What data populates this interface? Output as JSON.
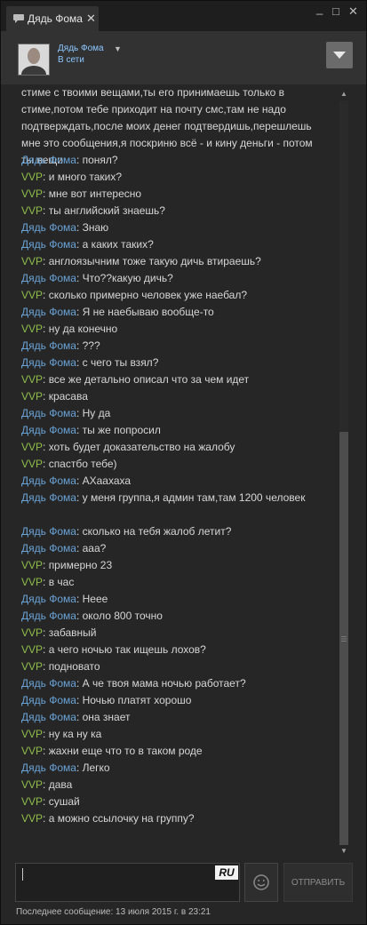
{
  "tab": {
    "title": "Дядь Фома",
    "close": "✕"
  },
  "window_controls": {
    "minimize": "_",
    "maximize": "□",
    "close": "✕"
  },
  "contact": {
    "name": "Дядь Фома",
    "status": "В сети"
  },
  "messages": [
    {
      "sender": "",
      "text": "стиме с твоими вещами,ты его принимаешь только в стиме,потом тебе приходит на почту смс,там не надо подтверждать,после моих денег подтвердишь,перешлешь мне это сообщения,я поскриню всё - и кину деньги - потом ты вещи"
    },
    {
      "sender": "Дядь Фома",
      "text": "понял?"
    },
    {
      "sender": "VVP",
      "text": "и много таких?"
    },
    {
      "sender": "VVP",
      "text": "мне вот интересно"
    },
    {
      "sender": "VVP",
      "text": "ты английский знаешь?"
    },
    {
      "sender": "Дядь Фома",
      "text": "Знаю"
    },
    {
      "sender": "Дядь Фома",
      "text": "а каких таких?"
    },
    {
      "sender": "VVP",
      "text": "англоязычним тоже такую дичь втираешь?"
    },
    {
      "sender": "Дядь Фома",
      "text": "Что??какую дичь?"
    },
    {
      "sender": "VVP",
      "text": "сколько примерно человек уже наебал?"
    },
    {
      "sender": "Дядь Фома",
      "text": "Я не наебываю вообще-то"
    },
    {
      "sender": "VVP",
      "text": "ну да конечно"
    },
    {
      "sender": "Дядь Фома",
      "text": "???"
    },
    {
      "sender": "Дядь Фома",
      "text": "с чего ты взял?"
    },
    {
      "sender": "VVP",
      "text": "все же детально описал что за чем идет"
    },
    {
      "sender": "VVP",
      "text": "красава"
    },
    {
      "sender": "Дядь Фома",
      "text": "Ну да"
    },
    {
      "sender": "Дядь Фома",
      "text": "ты же попросил"
    },
    {
      "sender": "VVP",
      "text": "хоть будет доказательство на жалобу"
    },
    {
      "sender": "VVP",
      "text": "спастбо тебе)"
    },
    {
      "sender": "Дядь Фома",
      "text": "АХаахаха"
    },
    {
      "sender": "Дядь Фома",
      "text": "у меня группа,я админ там,там 1200 человек"
    },
    {
      "sender": "Дядь Фома",
      "text": "сколько на тебя жалоб летит?"
    },
    {
      "sender": "Дядь Фома",
      "text": "ааа?"
    },
    {
      "sender": "VVP",
      "text": "примерно 23"
    },
    {
      "sender": "VVP",
      "text": "в час"
    },
    {
      "sender": "Дядь Фома",
      "text": "Неее"
    },
    {
      "sender": "Дядь Фома",
      "text": "около 800 точно"
    },
    {
      "sender": "VVP",
      "text": "забавный"
    },
    {
      "sender": "VVP",
      "text": "а чего ночью так ищешь лохов?"
    },
    {
      "sender": "VVP",
      "text": "подновато"
    },
    {
      "sender": "Дядь Фома",
      "text": "А че твоя мама ночью работает?"
    },
    {
      "sender": "Дядь Фома",
      "text": "Ночью платят хорошо"
    },
    {
      "sender": "Дядь Фома",
      "text": "она знает"
    },
    {
      "sender": "VVP",
      "text": "ну ка ну ка"
    },
    {
      "sender": "VVP",
      "text": "жахни еще что то в таком роде"
    },
    {
      "sender": "Дядь Фома",
      "text": "Легко"
    },
    {
      "sender": "VVP",
      "text": "дава"
    },
    {
      "sender": "VVP",
      "text": "сушай"
    },
    {
      "sender": "VVP",
      "text": "а можно ссылочку на группу?"
    }
  ],
  "input": {
    "value": "",
    "lang": "RU"
  },
  "send_label": "ОТПРАВИТЬ",
  "last_message": "Последнее сообщение: 13 июля 2015 г. в 23:21",
  "colors": {
    "sender_a": "#6aa3d6",
    "sender_b": "#8ebd4a",
    "text": "#d6d6d6"
  },
  "icons": [
    "chat-icon",
    "close-icon",
    "minimize-icon",
    "maximize-icon",
    "dropdown-arrow-icon",
    "menu-arrow-icon",
    "emoticon-icon",
    "scroll-up-icon",
    "scroll-down-icon"
  ]
}
